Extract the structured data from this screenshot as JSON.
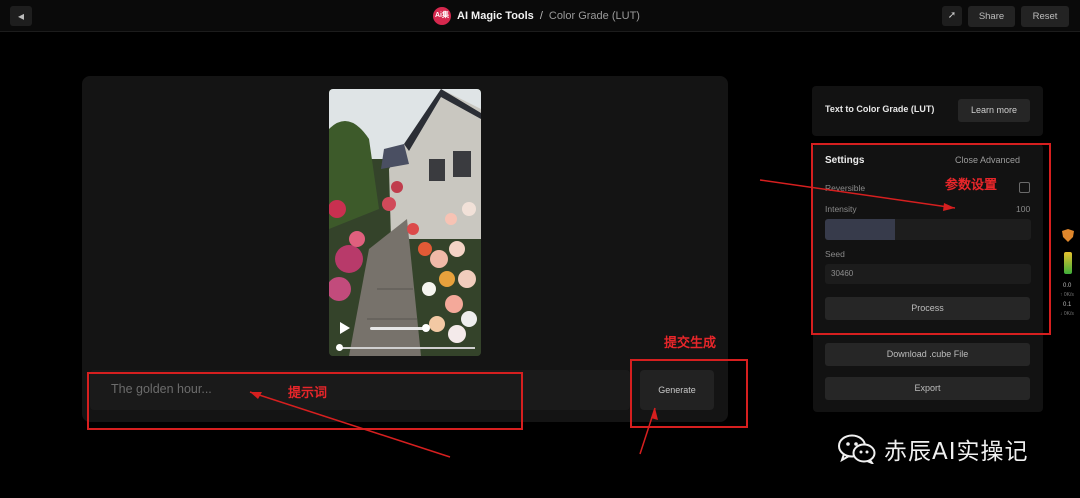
{
  "header": {
    "back_icon": "arrow-left-icon",
    "logo_text": "Ai集",
    "app_name": "AI Magic Tools",
    "separator": "/",
    "page_name": "Color Grade (LUT)",
    "pin_icon": "pin-icon",
    "share_label": "Share",
    "reset_label": "Reset"
  },
  "editor": {
    "prompt_placeholder": "The golden hour...",
    "generate_label": "Generate",
    "play_icon": "play-icon"
  },
  "panel": {
    "title": "Text to Color Grade (LUT)",
    "learn_more_label": "Learn more",
    "settings": {
      "title": "Settings",
      "close_advanced_label": "Close Advanced",
      "reversible_label": "Reversible",
      "reversible_checked": false,
      "intensity_label": "Intensity",
      "intensity_value": "100",
      "intensity_fraction": 0.34,
      "seed_label": "Seed",
      "seed_value": "30460",
      "process_label": "Process"
    },
    "download_cube_label": "Download .cube File",
    "export_label": "Export"
  },
  "side_strip": {
    "line1": "0.0",
    "line2": "↑ 0K/s",
    "line3": "0.1",
    "line4": "↓ 0K/s"
  },
  "annotations": {
    "color": "#d61f1f",
    "prompt_note": "提示词",
    "generate_note": "提交生成",
    "settings_note": "参数设置"
  },
  "watermark": {
    "text": "赤辰AI实操记",
    "icon": "wechat-icon"
  }
}
